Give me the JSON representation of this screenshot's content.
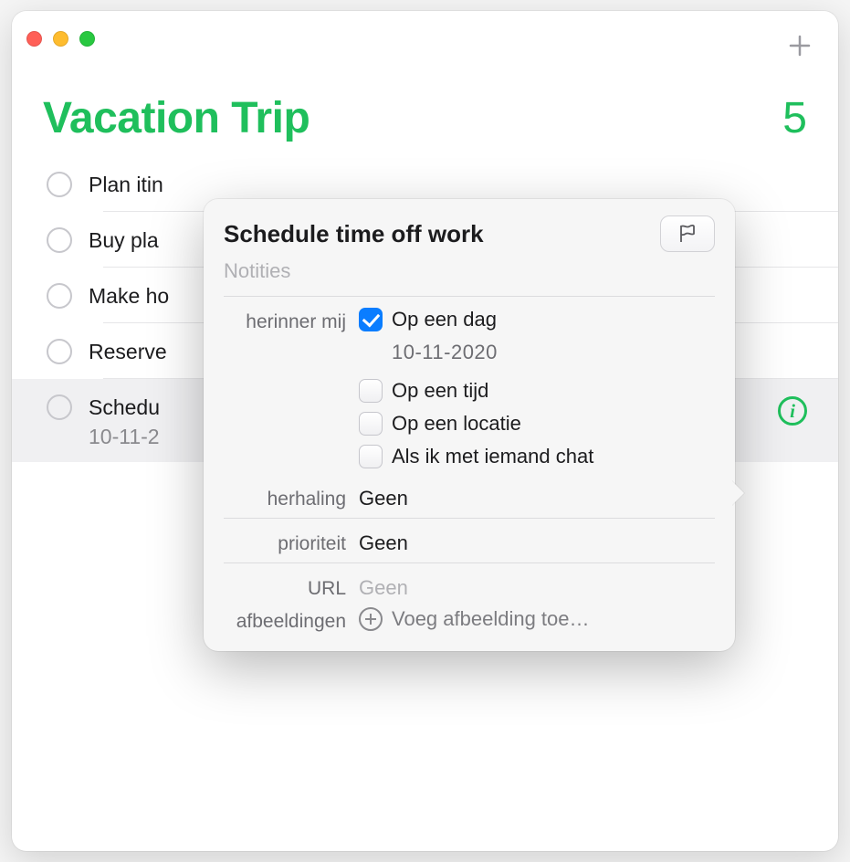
{
  "list": {
    "title": "Vacation Trip",
    "count": "5",
    "accent_color": "#1fbf5c"
  },
  "items": [
    {
      "title": "Plan itin",
      "date": ""
    },
    {
      "title": "Buy pla",
      "date": ""
    },
    {
      "title": "Make ho",
      "date": ""
    },
    {
      "title": "Reserve",
      "date": ""
    },
    {
      "title": "Schedu",
      "date": "10-11-2"
    }
  ],
  "popover": {
    "title": "Schedule time off work",
    "notes_placeholder": "Notities",
    "remind_label": "herinner mij",
    "on_day_label": "Op een dag",
    "on_day_date": "10-11-2020",
    "on_time_label": "Op een tijd",
    "on_location_label": "Op een locatie",
    "when_messaging_label": "Als ik met iemand chat",
    "repeat_label": "herhaling",
    "repeat_value": "Geen",
    "priority_label": "prioriteit",
    "priority_value": "Geen",
    "url_label": "URL",
    "url_placeholder": "Geen",
    "images_label": "afbeeldingen",
    "add_image_label": "Voeg afbeelding toe…"
  }
}
